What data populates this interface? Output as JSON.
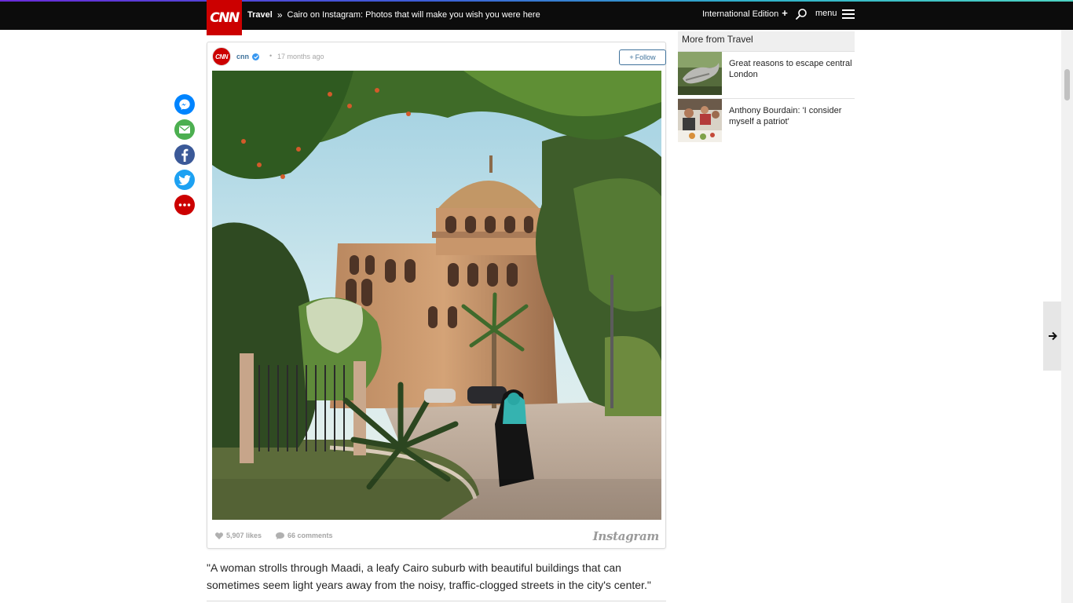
{
  "nav": {
    "logo_text": "CNN",
    "section": "Travel",
    "separator": "»",
    "title": "Cairo on Instagram: Photos that will make you wish you were here",
    "edition_label": "International Edition",
    "edition_plus": "+",
    "menu_label": "menu",
    "accent_colors": [
      "#6a2bd9",
      "#3c5ed7",
      "#2fb1c9",
      "#4ed3c4"
    ],
    "brand_color": "#cc0000"
  },
  "share": {
    "items": [
      {
        "name": "messenger-icon",
        "color": "#0084ff"
      },
      {
        "name": "email-icon",
        "color": "#4caf50"
      },
      {
        "name": "facebook-icon",
        "color": "#3b5998"
      },
      {
        "name": "twitter-icon",
        "color": "#1da1f2"
      },
      {
        "name": "more-icon",
        "color": "#cc0000"
      }
    ]
  },
  "embed": {
    "avatar_text": "CNN",
    "username": "cnn",
    "time_ago": "17 months ago",
    "follow_label": "Follow",
    "follow_plus": "+",
    "likes": "5,907 likes",
    "comments": "66 comments",
    "brand": "Instagram"
  },
  "caption": {
    "text": "\"A woman strolls through Maadi, a leafy Cairo suburb with beautiful buildings that can sometimes seem light years away from the noisy, traffic-clogged streets in the city's center.\""
  },
  "rail": {
    "heading": "More from Travel",
    "items": [
      {
        "title": "Great reasons to escape central London"
      },
      {
        "title": "Anthony Bourdain: 'I consider myself a patriot'"
      }
    ]
  }
}
